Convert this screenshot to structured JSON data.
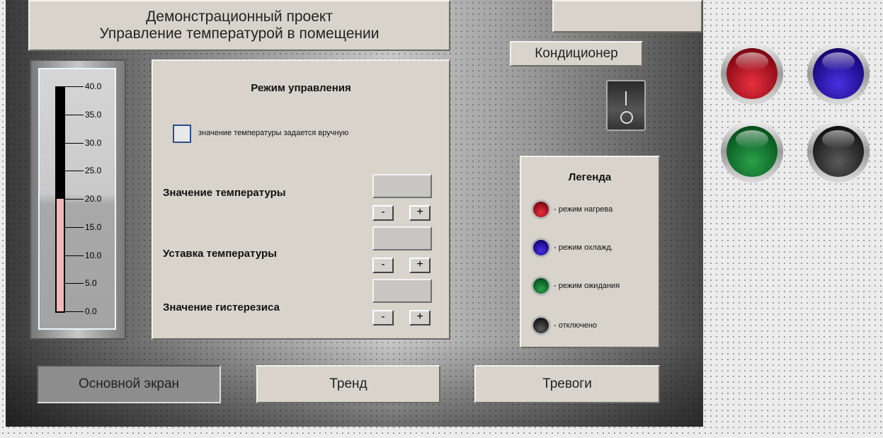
{
  "header": {
    "title_line1": "Демонстрационный проект",
    "title_line2": "Управление температурой в помещении"
  },
  "conditioner": {
    "label": "Кондиционер"
  },
  "thermometer": {
    "ticks": [
      "40.0",
      "35.0",
      "30.0",
      "25.0",
      "20.0",
      "15.0",
      "10.0",
      "5.0",
      "0.0"
    ],
    "level": 20.0,
    "max": 40.0,
    "fill_color": "#f2b8b8"
  },
  "control": {
    "title": "Режим управления",
    "manual_checkbox_label": "значение температуры задается вручную",
    "fields": [
      {
        "label": "Значение температуры",
        "value": ""
      },
      {
        "label": "Уставка температуры",
        "value": ""
      },
      {
        "label": "Значение гистерезиса",
        "value": ""
      }
    ],
    "minus_label": "-",
    "plus_label": "+"
  },
  "legend": {
    "title": "Легенда",
    "items": [
      {
        "text": "- режим нагрева",
        "color": "red"
      },
      {
        "text": "- режим охлажд.",
        "color": "blue"
      },
      {
        "text": "- режим ожидания",
        "color": "green"
      },
      {
        "text": "- отключено",
        "color": "black"
      }
    ]
  },
  "nav": {
    "main": "Основной экран",
    "trend": "Тренд",
    "alarms": "Тревоги"
  }
}
